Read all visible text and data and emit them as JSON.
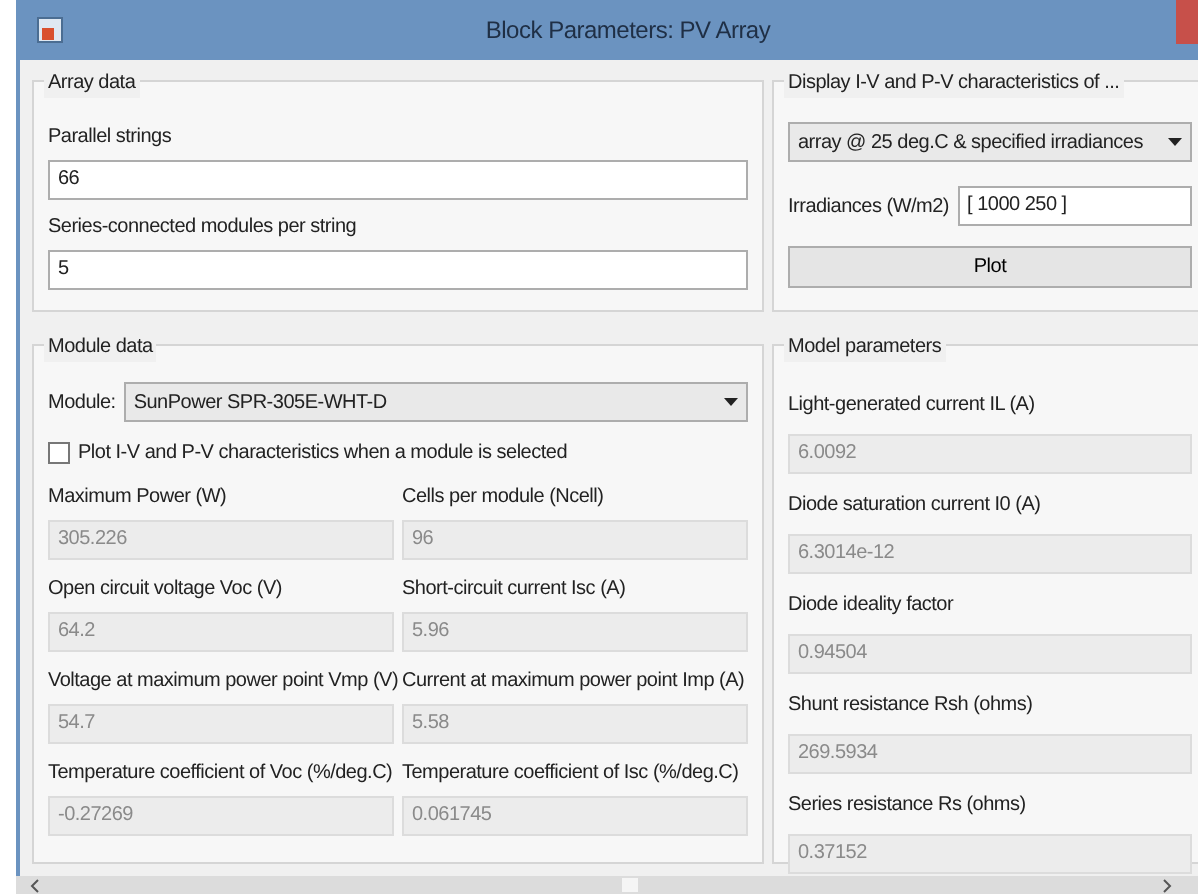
{
  "window": {
    "title": "Block Parameters: PV Array"
  },
  "array_data": {
    "title": "Array data",
    "fields": [
      {
        "label": "Parallel strings",
        "value": "66",
        "disabled": false
      },
      {
        "label": "Series-connected modules per string",
        "value": "5",
        "disabled": false
      }
    ]
  },
  "display": {
    "title": "Display  I-V and P-V characteristics of ...",
    "dropdown": {
      "value": "array @ 25 deg.C & specified irradiances"
    },
    "irradiances": {
      "label": "Irradiances (W/m2)",
      "value": "[ 1000  250 ]"
    },
    "button": "Plot"
  },
  "module_data": {
    "title": "Module data",
    "module": {
      "label": "Module:",
      "value": "SunPower SPR-305E-WHT-D"
    },
    "checkbox": {
      "label": "Plot I-V and P-V characteristics when a module is selected",
      "checked": false
    },
    "fields": [
      {
        "label": "Maximum Power (W)",
        "value": "305.226",
        "disabled": true
      },
      {
        "label": "Cells per module (Ncell)",
        "value": "96",
        "disabled": true
      },
      {
        "label": "Open circuit voltage  Voc (V)",
        "value": "64.2",
        "disabled": true
      },
      {
        "label": "Short-circuit current Isc (A)",
        "value": "5.96",
        "disabled": true
      },
      {
        "label": "Voltage at maximum power point Vmp (V)",
        "value": "54.7",
        "disabled": true
      },
      {
        "label": "Current at maximum power point Imp (A)",
        "value": "5.58",
        "disabled": true
      },
      {
        "label": "Temperature coefficient of Voc (%/deg.C)",
        "value": "-0.27269",
        "disabled": true
      },
      {
        "label": "Temperature coefficient of Isc (%/deg.C)",
        "value": "0.061745",
        "disabled": true
      }
    ]
  },
  "model_parameters": {
    "title": "Model parameters",
    "fields": [
      {
        "label": "Light-generated current IL (A)",
        "value": "6.0092",
        "disabled": true
      },
      {
        "label": "Diode saturation current I0 (A)",
        "value": "6.3014e-12",
        "disabled": true
      },
      {
        "label": "Diode ideality factor",
        "value": "0.94504",
        "disabled": true
      },
      {
        "label": "Shunt resistance Rsh (ohms)",
        "value": "269.5934",
        "disabled": true
      },
      {
        "label": "Series resistance Rs (ohms)",
        "value": "0.37152",
        "disabled": true
      }
    ]
  }
}
